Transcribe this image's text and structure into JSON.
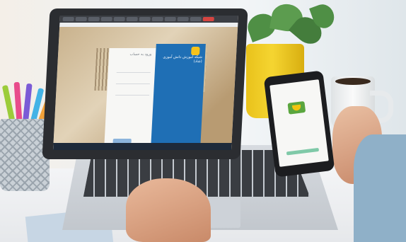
{
  "scene": {
    "description_items": [
      "laptop",
      "smartphone",
      "plant",
      "coffee-mug",
      "pencil-cup"
    ]
  },
  "laptop_screen": {
    "panel_title": "شبکه آموزش دانش آموزی (شاد)",
    "form_heading": "ورود به حساب"
  },
  "colors": {
    "panel_blue": "#1f6fb5",
    "app_green": "#5aa63e",
    "pot_yellow": "#f5d531"
  }
}
